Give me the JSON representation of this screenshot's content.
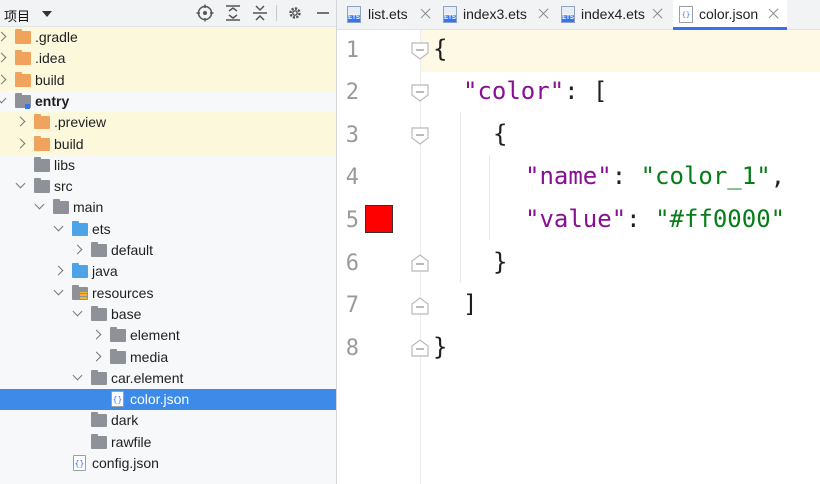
{
  "project_panel": {
    "title": "项目",
    "toolbar_icons": [
      "crosshair-icon",
      "expand-all-icon",
      "collapse-all-icon",
      "gear-icon",
      "minimize-icon"
    ],
    "tree": [
      {
        "label": ".gradle",
        "depth": 0,
        "expand": "closed",
        "icon": "folder-orange",
        "highlight": true
      },
      {
        "label": ".idea",
        "depth": 0,
        "expand": "closed",
        "icon": "folder-orange",
        "highlight": true
      },
      {
        "label": "build",
        "depth": 0,
        "expand": "closed",
        "icon": "folder-orange",
        "highlight": true
      },
      {
        "label": "entry",
        "depth": 0,
        "expand": "open",
        "icon": "folder-module",
        "bold": true
      },
      {
        "label": ".preview",
        "depth": 1,
        "expand": "closed",
        "icon": "folder-orange",
        "highlight": true
      },
      {
        "label": "build",
        "depth": 1,
        "expand": "closed",
        "icon": "folder-orange",
        "highlight": true
      },
      {
        "label": "libs",
        "depth": 1,
        "expand": "none",
        "icon": "folder-gray"
      },
      {
        "label": "src",
        "depth": 1,
        "expand": "open",
        "icon": "folder-gray"
      },
      {
        "label": "main",
        "depth": 2,
        "expand": "open",
        "icon": "folder-gray"
      },
      {
        "label": "ets",
        "depth": 3,
        "expand": "open",
        "icon": "folder-blue"
      },
      {
        "label": "default",
        "depth": 4,
        "expand": "closed",
        "icon": "folder-gray"
      },
      {
        "label": "java",
        "depth": 3,
        "expand": "closed",
        "icon": "folder-blue"
      },
      {
        "label": "resources",
        "depth": 3,
        "expand": "open",
        "icon": "folder-resources"
      },
      {
        "label": "base",
        "depth": 4,
        "expand": "open",
        "icon": "folder-gray"
      },
      {
        "label": "element",
        "depth": 5,
        "expand": "closed",
        "icon": "folder-gray"
      },
      {
        "label": "media",
        "depth": 5,
        "expand": "closed",
        "icon": "folder-gray"
      },
      {
        "label": "car.element",
        "depth": 4,
        "expand": "open",
        "icon": "folder-gray"
      },
      {
        "label": "color.json",
        "depth": 5,
        "expand": "none",
        "icon": "json-file",
        "selected": true
      },
      {
        "label": "dark",
        "depth": 4,
        "expand": "none",
        "icon": "folder-gray"
      },
      {
        "label": "rawfile",
        "depth": 4,
        "expand": "none",
        "icon": "folder-gray"
      },
      {
        "label": "config.json",
        "depth": 3,
        "expand": "none",
        "icon": "json-file"
      }
    ]
  },
  "tabs": [
    {
      "label": "list.ets",
      "icon": "ets-file-icon",
      "active": false
    },
    {
      "label": "index3.ets",
      "icon": "ets-file-icon",
      "active": false
    },
    {
      "label": "index4.ets",
      "icon": "ets-file-icon",
      "active": false
    },
    {
      "label": "color.json",
      "icon": "json-file-icon",
      "active": true
    }
  ],
  "editor": {
    "line_numbers": [
      "1",
      "2",
      "3",
      "4",
      "5",
      "6",
      "7",
      "8"
    ],
    "swatch_color": "#ff0000",
    "code_lines": [
      {
        "brace_open": "{"
      },
      {
        "key": "\"color\"",
        "rest": ": ["
      },
      {
        "brace": "{"
      },
      {
        "key": "\"name\"",
        "sep": ": ",
        "value": "\"color_1\"",
        "tail": ","
      },
      {
        "key": "\"value\"",
        "sep": ": ",
        "value": "\"#ff0000\"",
        "tail": ""
      },
      {
        "brace": "}"
      },
      {
        "brace": "]"
      },
      {
        "brace": "}"
      }
    ]
  },
  "colors": {
    "selection": "#3d8ae9",
    "key": "#871094",
    "string": "#067d17",
    "highlight_row": "#fbf8dc",
    "accent": "#3574f0"
  }
}
